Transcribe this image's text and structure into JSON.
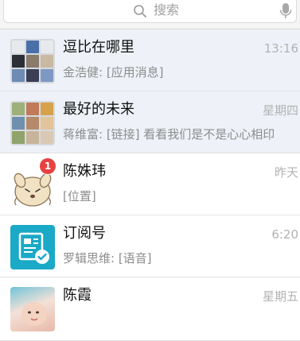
{
  "search": {
    "placeholder": "搜索"
  },
  "chats": [
    {
      "name": "逗比在哪里",
      "time": "13:16",
      "preview": "金浩健: [应用消息]",
      "pinned": true,
      "avatar": "group-photo-grid"
    },
    {
      "name": "最好的未来",
      "time": "星期四",
      "preview": "蒋维富: [链接] 看看我们是不是心心相印",
      "pinned": true,
      "avatar": "group-photo-grid"
    },
    {
      "name": "陈姝玮",
      "time": "昨天",
      "preview": "[位置]",
      "pinned": false,
      "avatar": "cartoon-bun-avatar",
      "unread": "1"
    },
    {
      "name": "订阅号",
      "time": "6:20",
      "preview": "罗辑思维: [语音]",
      "pinned": false,
      "avatar": "subscription-icon"
    },
    {
      "name": "陈霞",
      "time": "星期五",
      "preview": "",
      "pinned": false,
      "avatar": "baby-photo"
    }
  ],
  "colors": {
    "badge": "#e64340",
    "subscription_icon": "#1aa9c7",
    "pinned_row": "#eef2f8"
  }
}
